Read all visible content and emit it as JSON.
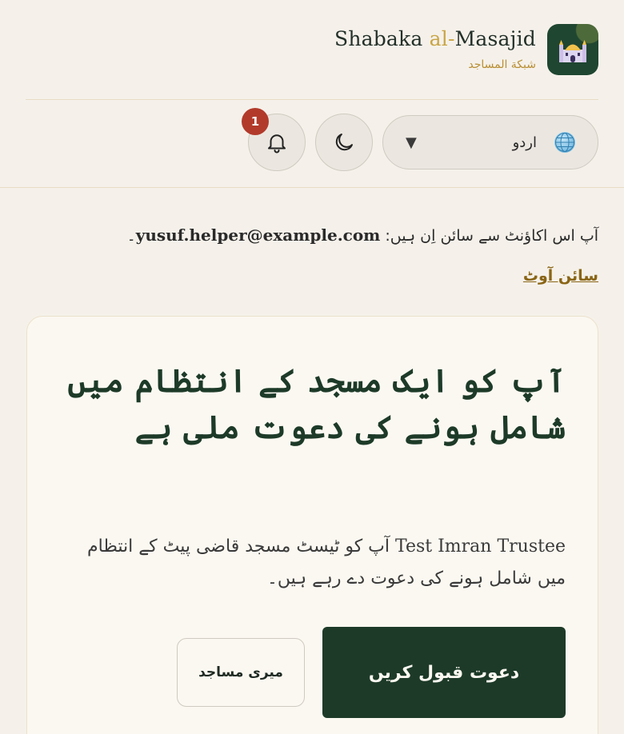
{
  "brand": {
    "name_prefix": "Shabaka ",
    "name_accent": "al-",
    "name_suffix": "Masajid",
    "subtitle": "شبكة المساجد",
    "logo_icon": "mosque-icon"
  },
  "controls": {
    "notifications": {
      "icon": "bell-icon",
      "count": "1"
    },
    "theme_toggle": {
      "icon": "moon-icon"
    },
    "language": {
      "icon": "globe-icon",
      "selected": "اردو",
      "caret": "▼"
    }
  },
  "account": {
    "signed_in_text": "آپ اس اکاؤنٹ سے سائن اِن ہیں:",
    "email": "yusuf.helper@example.com",
    "period": "۔",
    "sign_out": "سائن آوٹ"
  },
  "invite": {
    "title": "آپ کو ایک مسجد کے انتظام میں شامل ہونے کی دعوت ملی ہے",
    "inviter": "Test Imran Trustee",
    "body": "آپ کو ٹیسٹ مسجد قاضی پیٹ کے انتظام میں شامل ہونے کی دعوت دے رہے ہیں۔",
    "accept_label": "دعوت قبول کریں",
    "my_mosques_label": "میری مساجد"
  },
  "colors": {
    "background": "#f5f1ea",
    "primary": "#1d3a28",
    "accent_gold": "#c9a545",
    "badge_red": "#b23a2b"
  }
}
